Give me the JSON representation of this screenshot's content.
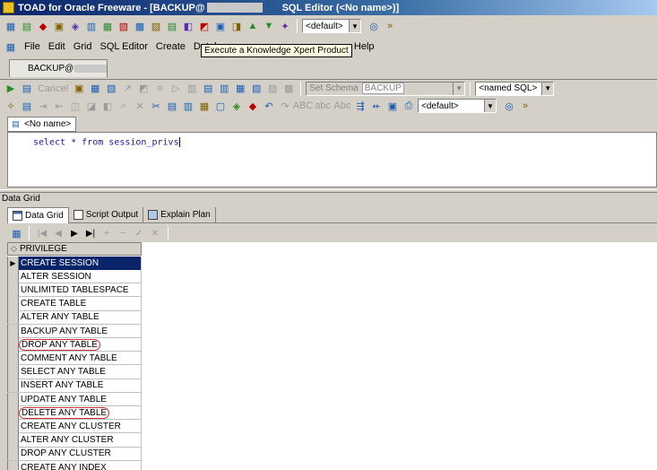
{
  "window": {
    "title_prefix": "TOAD for Oracle Freeware - [BACKUP@",
    "title_suffix": "SQL Editor (<No name>)]"
  },
  "menu": {
    "items": [
      "File",
      "Edit",
      "Grid",
      "SQL Editor",
      "Create",
      "Databa",
      "y",
      "Help"
    ]
  },
  "tooltip": {
    "text": "Execute a Knowledge Xpert Product"
  },
  "combos": {
    "top_default": "<default>",
    "schema_label": "Set Schema",
    "schema_value": "BACKUP",
    "named_sql": "<named SQL>",
    "format_default": "<default>"
  },
  "toolbar": {
    "cancel_label": "Cancel"
  },
  "connection_tab": {
    "label": "BACKUP@"
  },
  "doc_tab": {
    "label": "<No name>"
  },
  "editor": {
    "sql": "select * from session_privs"
  },
  "section": {
    "label": "Data Grid"
  },
  "result_tabs": {
    "data_grid": "Data Grid",
    "script_output": "Script Output",
    "explain_plan": "Explain Plan"
  },
  "grid": {
    "column": "PRIVILEGE",
    "rows": [
      "CREATE SESSION",
      "ALTER SESSION",
      "UNLIMITED TABLESPACE",
      "CREATE TABLE",
      "ALTER ANY TABLE",
      "BACKUP ANY TABLE",
      "DROP ANY TABLE",
      "COMMENT ANY TABLE",
      "SELECT ANY TABLE",
      "INSERT ANY TABLE",
      "UPDATE ANY TABLE",
      "DELETE ANY TABLE",
      "CREATE ANY CLUSTER",
      "ALTER ANY CLUSTER",
      "DROP ANY CLUSTER",
      "CREATE ANY INDEX"
    ],
    "selected_index": 0,
    "highlighted": [
      "DROP ANY TABLE",
      "DELETE ANY TABLE"
    ]
  }
}
